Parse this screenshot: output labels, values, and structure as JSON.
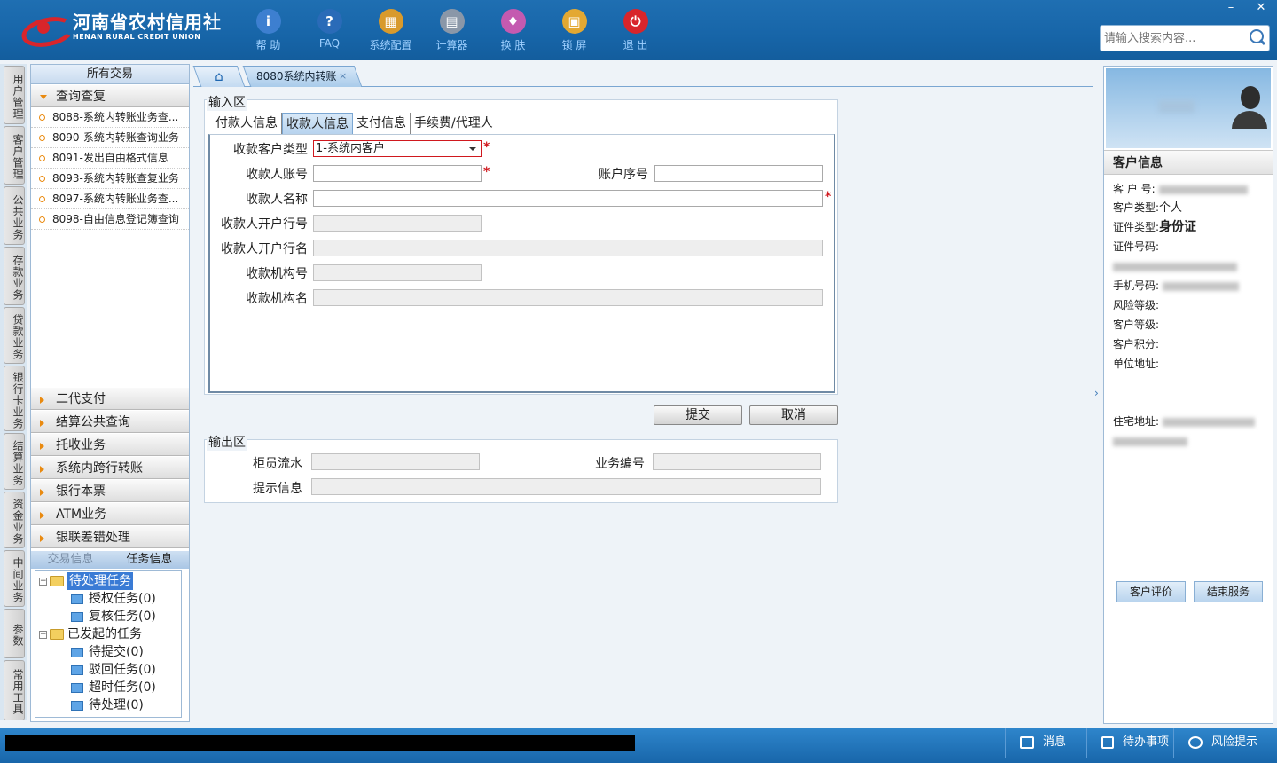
{
  "brand": {
    "name_cn": "河南省农村信用社",
    "name_en": "HENAN RURAL CREDIT UNION",
    "accent": "#1765a8",
    "logo_red": "#d8252b"
  },
  "toolbar": [
    {
      "label": "帮 助",
      "icon": "info-icon",
      "color": "#3d7fd0",
      "glyph": "i"
    },
    {
      "label": "FAQ",
      "icon": "question-icon",
      "color": "#2a6bb8",
      "glyph": "?"
    },
    {
      "label": "系统配置",
      "icon": "toolbox-icon",
      "color": "#d89a2c",
      "glyph": "▦"
    },
    {
      "label": "计算器",
      "icon": "calculator-icon",
      "color": "#8a97a8",
      "glyph": "▤"
    },
    {
      "label": "换 肤",
      "icon": "shirt-icon",
      "color": "#c45ab0",
      "glyph": "♦"
    },
    {
      "label": "锁 屏",
      "icon": "lock-icon",
      "color": "#e3a832",
      "glyph": "▣"
    },
    {
      "label": "退 出",
      "icon": "power-icon",
      "color": "#d8252b",
      "glyph": "⏻"
    }
  ],
  "search": {
    "placeholder": "请输入搜索内容..."
  },
  "window": {
    "minimize": "–",
    "close": "✕"
  },
  "vtabs": [
    "用户管理",
    "客户管理",
    "公共业务",
    "存款业务",
    "贷款业务",
    "银行卡业务",
    "结算业务",
    "资金业务",
    "中间业务",
    "参数",
    "常用工具"
  ],
  "leftpanel": {
    "title": "所有交易",
    "open_group": "查询查复",
    "items": [
      "8088-系统内转账业务查...",
      "8090-系统内转账查询业务",
      "8091-发出自由格式信息",
      "8093-系统内转账查复业务",
      "8097-系统内转账业务查...",
      "8098-自由信息登记簿查询"
    ],
    "groups": [
      "二代支付",
      "结算公共查询",
      "托收业务",
      "系统内跨行转账",
      "银行本票",
      "ATM业务",
      "银联差错处理"
    ],
    "task_tabs": [
      "交易信息",
      "任务信息"
    ],
    "tree": {
      "pending": "待处理任务",
      "pending_children": [
        "授权任务(0)",
        "复核任务(0)"
      ],
      "initiated": "已发起的任务",
      "initiated_children": [
        "待提交(0)",
        "驳回任务(0)",
        "超时任务(0)",
        "待处理(0)"
      ]
    }
  },
  "tabs": {
    "active": "8080系统内转账",
    "close": "×"
  },
  "input": {
    "section": "输入区",
    "subtabs": [
      "付款人信息",
      "收款人信息",
      "支付信息",
      "手续费/代理人"
    ],
    "fields": {
      "cust_type": "收款客户类型",
      "cust_type_value": "1-系统内客户",
      "account": "收款人账号",
      "seq": "账户序号",
      "name": "收款人名称",
      "bank_no": "收款人开户行号",
      "bank_name": "收款人开户行名",
      "org_no": "收款机构号",
      "org_name": "收款机构名"
    },
    "required_mark": "*",
    "submit": "提交",
    "cancel": "取消"
  },
  "output": {
    "section": "输出区",
    "teller_serial": "柜员流水",
    "biz_no": "业务编号",
    "hint": "提示信息"
  },
  "customer": {
    "title": "客户信息",
    "no_label": "客 户 号:",
    "type_label": "客户类型:",
    "type_value": "个人",
    "id_type_label": "证件类型:",
    "id_type_value": "身份证",
    "id_no_label": "证件号码:",
    "phone_label": "手机号码:",
    "risk_label": "风险等级:",
    "level_label": "客户等级:",
    "points_label": "客户积分:",
    "work_addr_label": "单位地址:",
    "home_addr_label": "住宅地址:",
    "evaluate": "客户评价",
    "end_service": "结束服务"
  },
  "statusbar": {
    "message": "消息",
    "todo": "待办事项",
    "risk": "风险提示"
  }
}
